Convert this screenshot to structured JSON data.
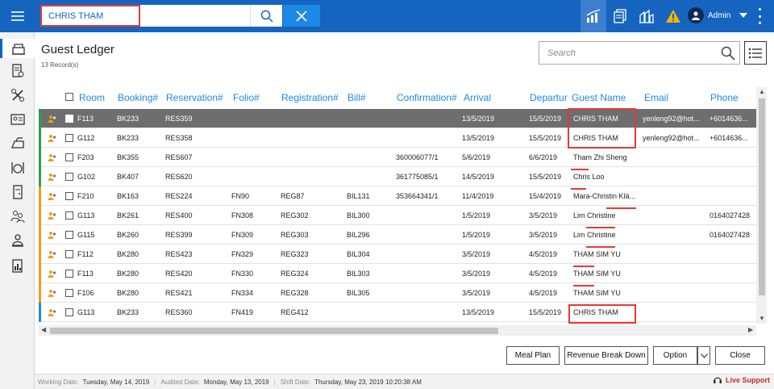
{
  "topbar": {
    "search_value": "CHRIS THAM",
    "admin_label": "Admin",
    "icons": [
      "menu-icon",
      "search-icon",
      "close-icon",
      "chart-icon",
      "documents-icon",
      "hotel-icon",
      "warning-icon",
      "user-icon",
      "chevron-down-icon",
      "more-icon"
    ],
    "accent": "#1565c0",
    "warning_color": "#f5b400"
  },
  "sidebar": {
    "icons": [
      "home-icon",
      "invoice-icon",
      "tools-icon",
      "contact-card-icon",
      "iron-icon",
      "dining-icon",
      "door-icon",
      "people-icon",
      "concierge-icon",
      "report-icon"
    ]
  },
  "page": {
    "title": "Guest Ledger",
    "record_count": "13 Record(s)",
    "search_placeholder": "Search"
  },
  "table": {
    "columns": [
      "Room",
      "Booking#",
      "Reservation#",
      "Folio#",
      "Registration#",
      "Bill#",
      "Confirmation#",
      "Arrival",
      "Departur",
      "Guest Name",
      "Email",
      "Phone"
    ],
    "rows": [
      {
        "status": "green",
        "selected": true,
        "room": "F113",
        "booking": "BK233",
        "reservation": "RES359",
        "folio": "",
        "registration": "",
        "bill": "",
        "confirmation": "",
        "arrival": "13/5/2019",
        "departure": "15/5/2019",
        "guest": "CHRIS THAM",
        "email": "yenleng92@hot...",
        "phone": "+6014636..."
      },
      {
        "status": "green",
        "selected": false,
        "room": "G112",
        "booking": "BK233",
        "reservation": "RES358",
        "folio": "",
        "registration": "",
        "bill": "",
        "confirmation": "",
        "arrival": "13/5/2019",
        "departure": "15/5/2019",
        "guest": "CHRIS THAM",
        "email": "yenleng92@hot...",
        "phone": "+6014636..."
      },
      {
        "status": "green",
        "selected": false,
        "room": "F203",
        "booking": "BK355",
        "reservation": "RES607",
        "folio": "",
        "registration": "",
        "bill": "",
        "confirmation": "360006077/1",
        "arrival": "5/6/2019",
        "departure": "6/6/2019",
        "guest": "Tham Zhi Sheng",
        "email": "",
        "phone": ""
      },
      {
        "status": "green",
        "selected": false,
        "room": "G102",
        "booking": "BK407",
        "reservation": "RES620",
        "folio": "",
        "registration": "",
        "bill": "",
        "confirmation": "361775085/1",
        "arrival": "14/5/2019",
        "departure": "15/5/2019",
        "guest": "Chris Loo",
        "email": "",
        "phone": ""
      },
      {
        "status": "orange",
        "selected": false,
        "room": "F210",
        "booking": "BK163",
        "reservation": "RES224",
        "folio": "FN90",
        "registration": "REG87",
        "bill": "BIL131",
        "confirmation": "353664341/1",
        "arrival": "11/4/2019",
        "departure": "15/4/2019",
        "guest": "Mara-Christin Klä...",
        "email": "",
        "phone": ""
      },
      {
        "status": "orange",
        "selected": false,
        "room": "G113",
        "booking": "BK261",
        "reservation": "RES400",
        "folio": "FN308",
        "registration": "REG302",
        "bill": "BIL300",
        "confirmation": "",
        "arrival": "1/5/2019",
        "departure": "3/5/2019",
        "guest": "Lim Christine",
        "email": "",
        "phone": "0164027428"
      },
      {
        "status": "orange",
        "selected": false,
        "room": "G115",
        "booking": "BK260",
        "reservation": "RES399",
        "folio": "FN309",
        "registration": "REG303",
        "bill": "BIL296",
        "confirmation": "",
        "arrival": "1/5/2019",
        "departure": "3/5/2019",
        "guest": "Lim Christine",
        "email": "",
        "phone": "0164027428"
      },
      {
        "status": "orange",
        "selected": false,
        "room": "F112",
        "booking": "BK280",
        "reservation": "RES423",
        "folio": "FN329",
        "registration": "REG323",
        "bill": "BIL304",
        "confirmation": "",
        "arrival": "3/5/2019",
        "departure": "4/5/2019",
        "guest": "THAM SIM YU",
        "email": "",
        "phone": ""
      },
      {
        "status": "orange",
        "selected": false,
        "room": "F113",
        "booking": "BK280",
        "reservation": "RES420",
        "folio": "FN330",
        "registration": "REG324",
        "bill": "BIL303",
        "confirmation": "",
        "arrival": "3/5/2019",
        "departure": "4/5/2019",
        "guest": "THAM SIM YU",
        "email": "",
        "phone": ""
      },
      {
        "status": "orange",
        "selected": false,
        "room": "F106",
        "booking": "BK280",
        "reservation": "RES421",
        "folio": "FN334",
        "registration": "REG328",
        "bill": "BIL305",
        "confirmation": "",
        "arrival": "3/5/2019",
        "departure": "4/5/2019",
        "guest": "THAM SIM YU",
        "email": "",
        "phone": ""
      },
      {
        "status": "blue",
        "selected": false,
        "room": "G113",
        "booking": "BK233",
        "reservation": "RES360",
        "folio": "FN419",
        "registration": "REG412",
        "bill": "",
        "confirmation": "",
        "arrival": "13/5/2019",
        "departure": "15/5/2019",
        "guest": "CHRIS THAM",
        "email": "",
        "phone": ""
      }
    ]
  },
  "status_colors": {
    "green": "#2e9e4f",
    "orange": "#f39c12",
    "blue": "#1e88e5"
  },
  "buttons": {
    "meal_plan": "Meal Plan",
    "revenue_break_down": "Revenue Break Down",
    "option": "Option",
    "close": "Close"
  },
  "statusbar": {
    "working_label": "Working Date:",
    "working_value": "Tuesday, May 14, 2019",
    "audited_label": "Audited Date:",
    "audited_value": "Monday, May 13, 2019",
    "shift_label": "Shift Date:",
    "shift_value": "Thursday, May 23, 2019 10:20:38 AM",
    "live_support": "Live Support"
  }
}
